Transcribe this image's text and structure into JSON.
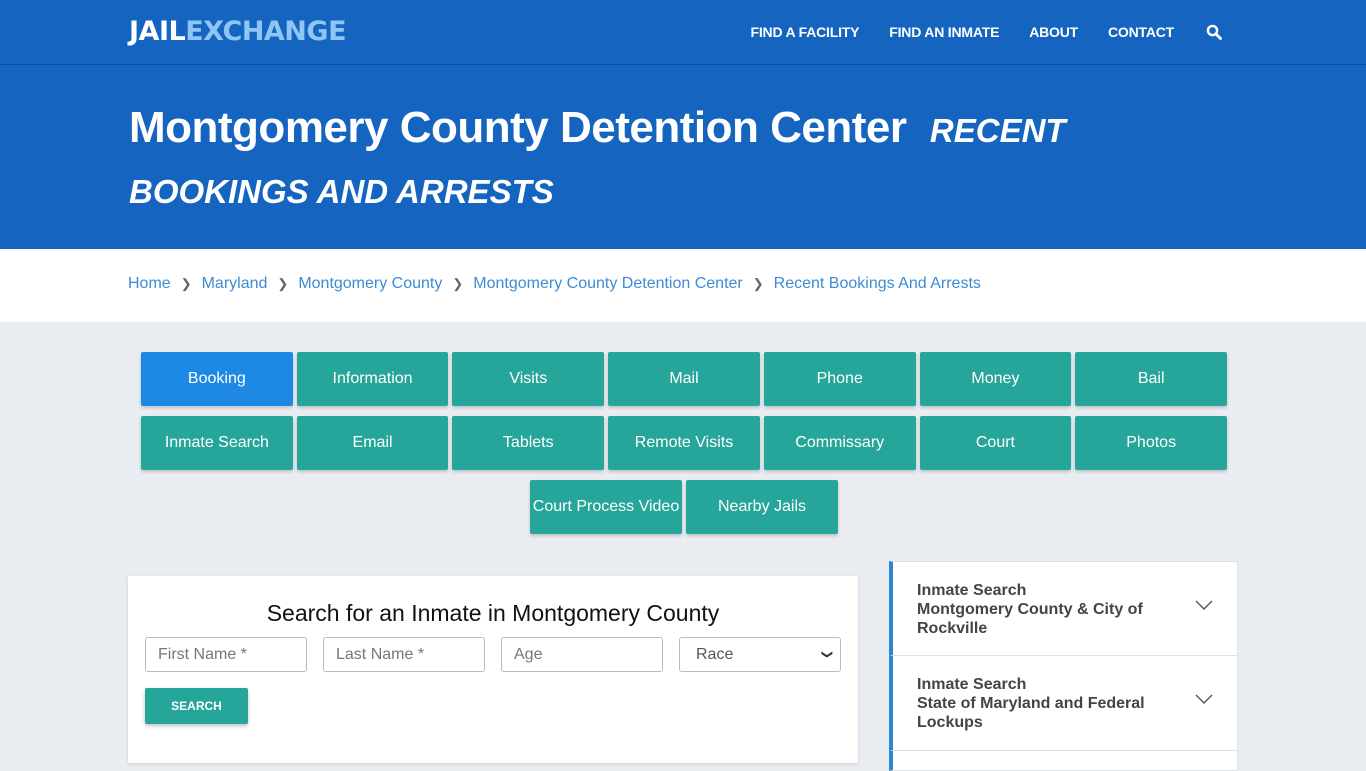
{
  "header": {
    "logo_part1": "JAIL",
    "logo_part2": "EXCHANGE",
    "nav": [
      "FIND A FACILITY",
      "FIND AN INMATE",
      "ABOUT",
      "CONTACT"
    ],
    "search_icon": "search-icon"
  },
  "hero": {
    "title": "Montgomery County Detention Center",
    "subtitle": "RECENT BOOKINGS AND ARRESTS"
  },
  "breadcrumb": [
    "Home",
    "Maryland",
    "Montgomery County",
    "Montgomery County Detention Center",
    "Recent Bookings And Arrests"
  ],
  "tabs": {
    "row1": [
      "Booking",
      "Information",
      "Visits",
      "Mail",
      "Phone",
      "Money",
      "Bail"
    ],
    "row2": [
      "Inmate Search",
      "Email",
      "Tablets",
      "Remote Visits",
      "Commissary",
      "Court",
      "Photos"
    ],
    "row3": [
      "Court Process Video",
      "Nearby Jails"
    ],
    "active": "Booking"
  },
  "search": {
    "title": "Search for an Inmate in Montgomery County",
    "first_name_placeholder": "First Name *",
    "last_name_placeholder": "Last Name *",
    "age_placeholder": "Age",
    "race_selected": "Race",
    "button": "SEARCH"
  },
  "sidebar": {
    "items": [
      {
        "line1": "Inmate Search",
        "line2": "Montgomery County & City of Rockville"
      },
      {
        "line1": "Inmate Search",
        "line2": "State of Maryland and Federal Lockups"
      }
    ]
  },
  "colors": {
    "brand_blue": "#1565c0",
    "teal": "#26a69a",
    "active_blue": "#1e88e5",
    "link_blue": "#3d8bd4"
  }
}
